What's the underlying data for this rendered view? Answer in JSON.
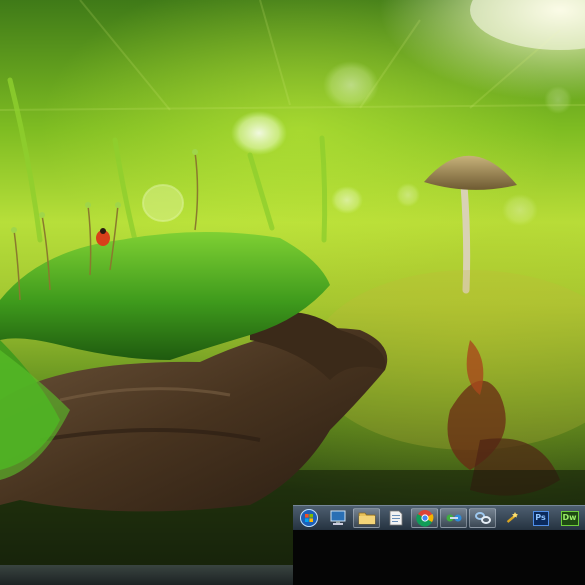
{
  "wallpaper": {
    "subject": "mossy-log-mushroom-ladybug",
    "colors": {
      "bright_green": "#b7df3a",
      "moss": "#3f8f1a",
      "bark": "#4a3524",
      "sunlight": "#fffbe0"
    }
  },
  "taskbar": {
    "background": "#2d3a48",
    "items": [
      {
        "name": "start-orb",
        "icon": "windows-start-orb-icon"
      },
      {
        "name": "show-desktop",
        "icon": "computer-monitor-icon"
      },
      {
        "name": "file-explorer",
        "icon": "folder-icon"
      },
      {
        "name": "document-viewer",
        "icon": "document-icon"
      },
      {
        "name": "chrome",
        "icon": "chrome-icon"
      },
      {
        "name": "network",
        "icon": "network-icon"
      },
      {
        "name": "connection-tool",
        "icon": "link-icon"
      },
      {
        "name": "utility",
        "icon": "wand-icon"
      },
      {
        "name": "photoshop",
        "icon": "photoshop-icon",
        "label": "Ps"
      },
      {
        "name": "dreamweaver",
        "icon": "dreamweaver-icon",
        "label": "Dw"
      }
    ]
  }
}
